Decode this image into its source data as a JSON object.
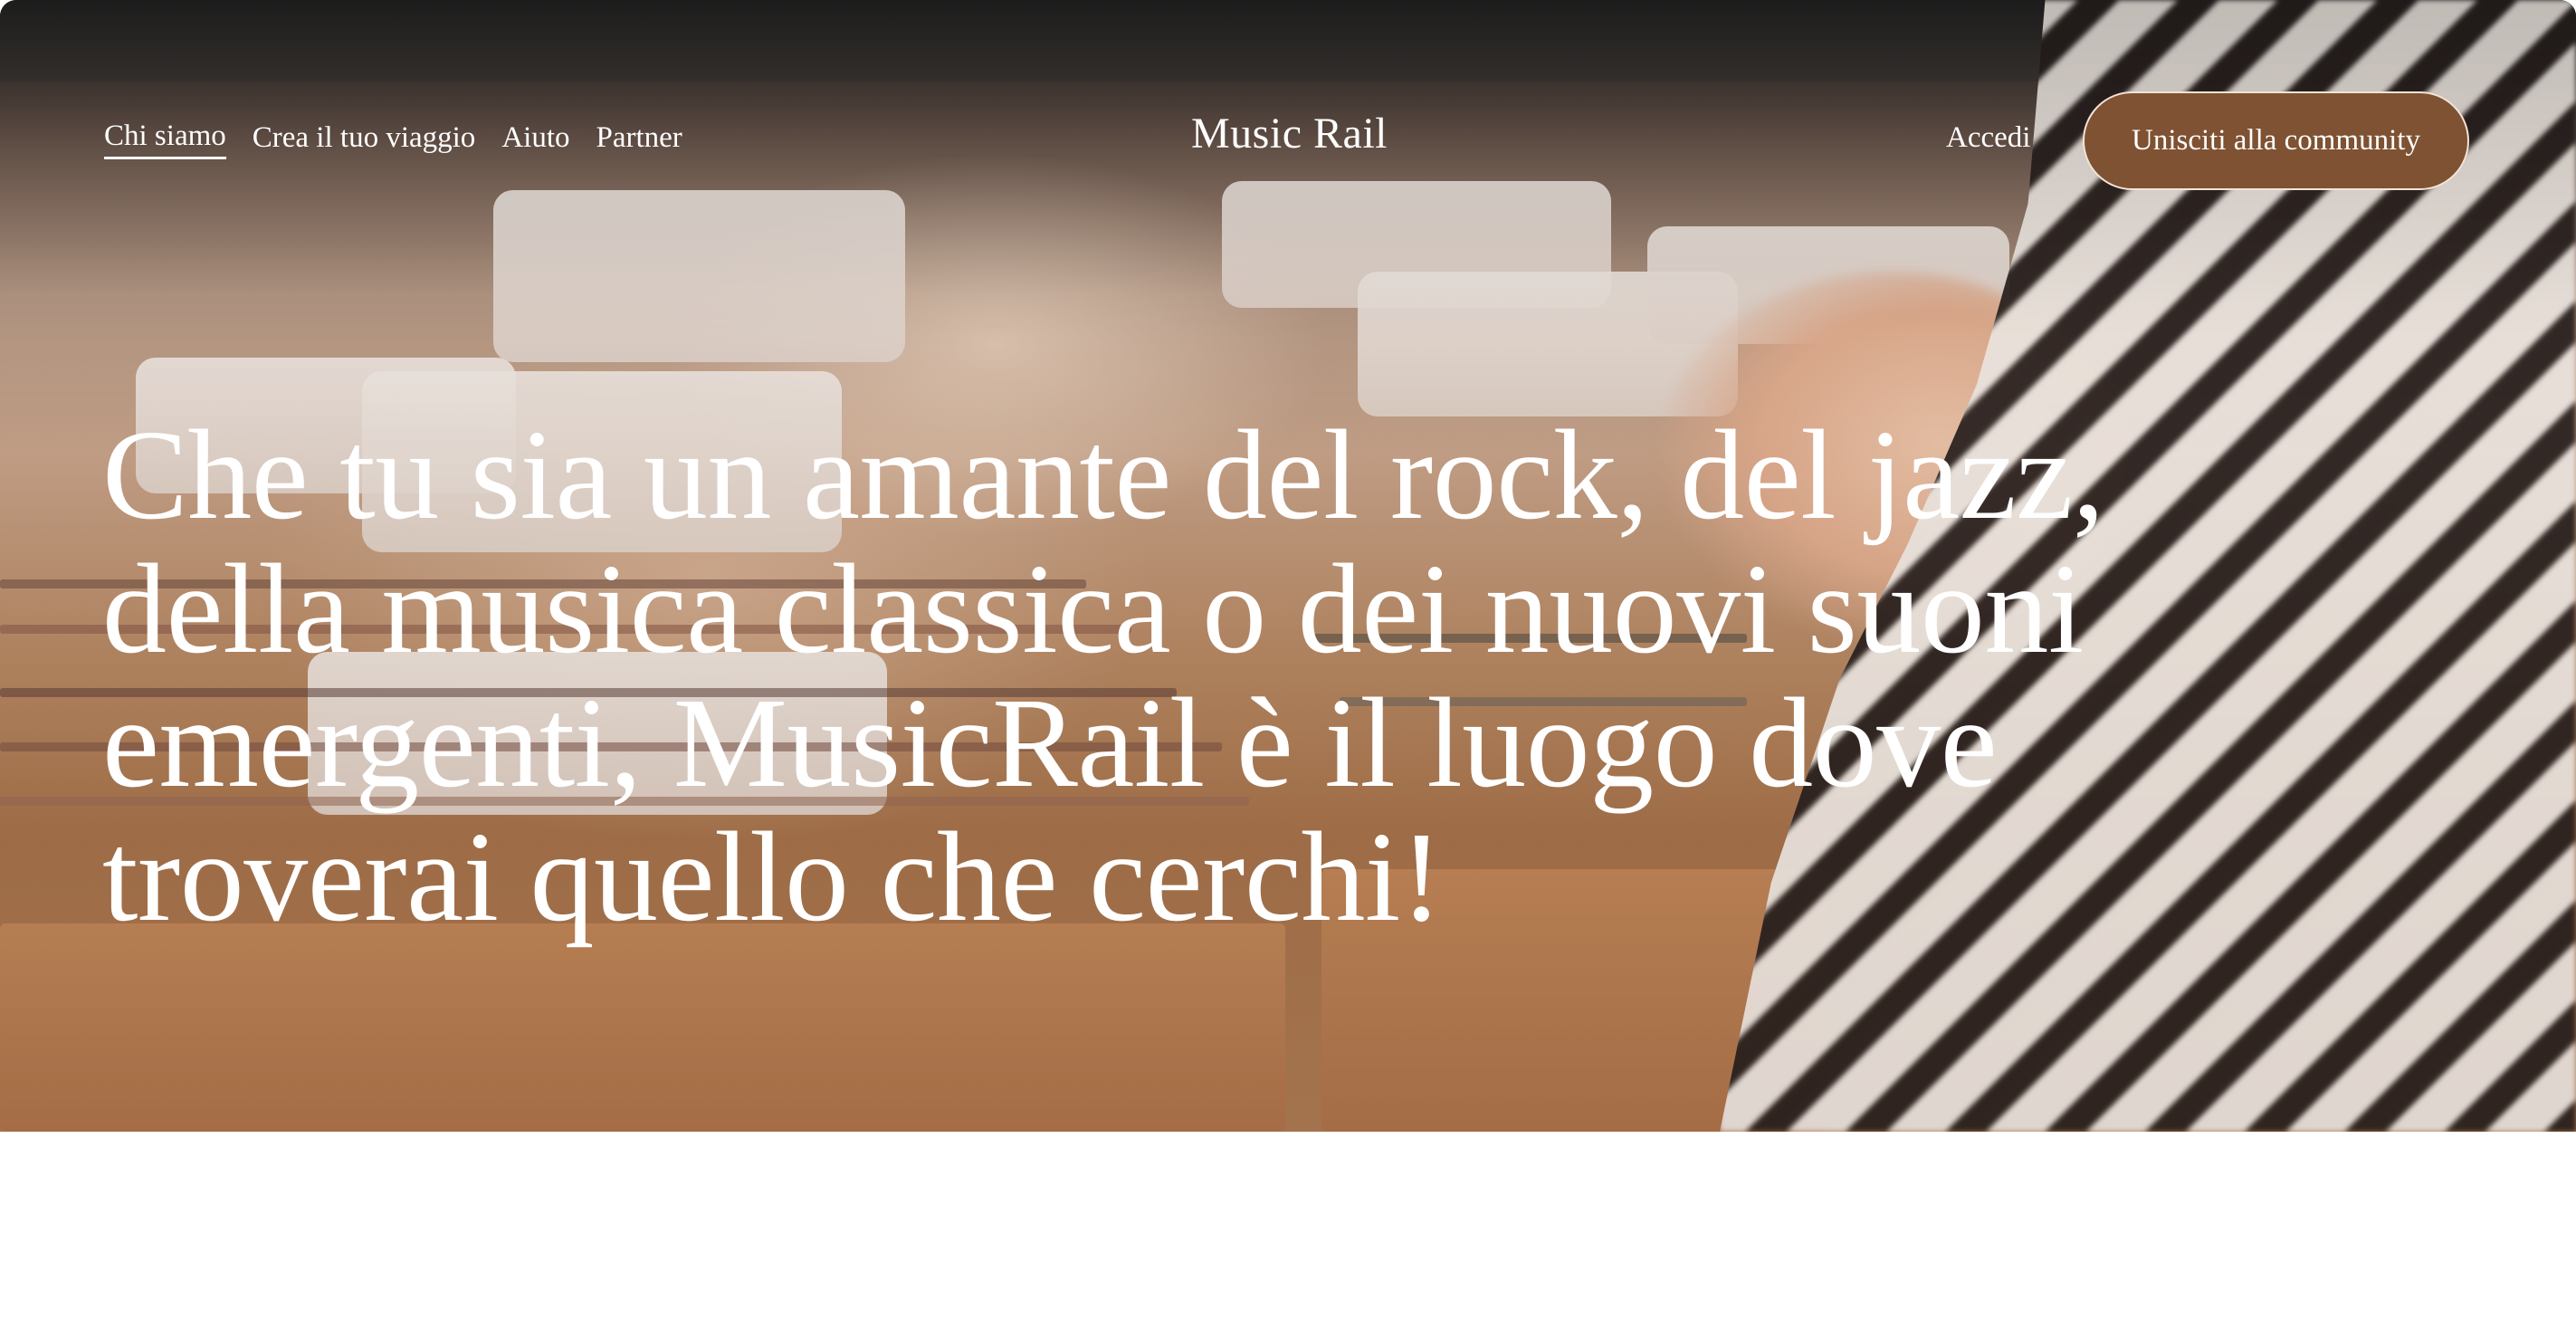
{
  "nav": {
    "links": [
      {
        "label": "Chi siamo",
        "active": true
      },
      {
        "label": "Crea il tuo viaggio",
        "active": false
      },
      {
        "label": "Aiuto",
        "active": false
      },
      {
        "label": "Partner",
        "active": false
      }
    ],
    "logo": "Music Rail",
    "login_label": "Accedi",
    "join_label": "Unisciti alla community"
  },
  "hero": {
    "headline": "Che tu sia un amante del rock, del jazz, della musica classica o dei nuovi suoni emergenti, MusicRail è il luogo dove troverai quello che cerchi!"
  },
  "colors": {
    "button_bg": "#7e5232",
    "button_border": "#f3e4d6",
    "text": "#ffffff",
    "page_bg": "#ffffff"
  }
}
